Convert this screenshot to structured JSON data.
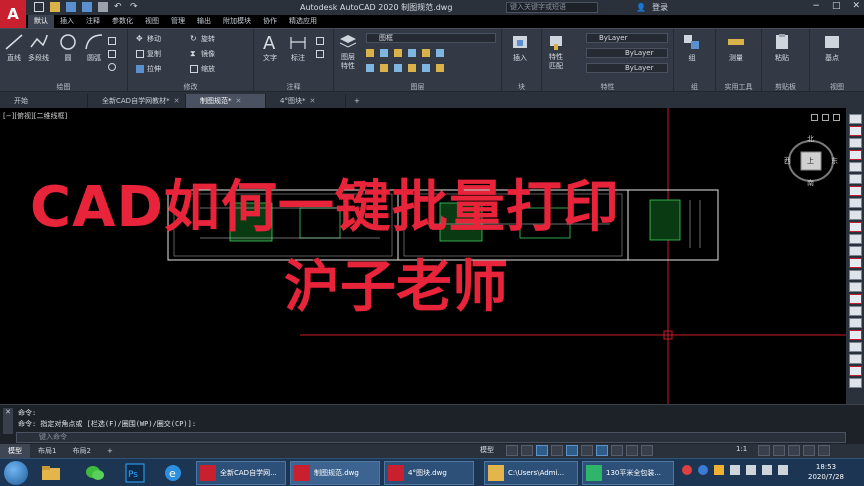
{
  "window": {
    "title": "Autodesk AutoCAD 2020    制图规范.dwg",
    "search_placeholder": "键入关键字或短语",
    "login": "登录",
    "app_logo": "A"
  },
  "ribbon_tabs": [
    "默认",
    "插入",
    "注释",
    "参数化",
    "视图",
    "管理",
    "输出",
    "附加模块",
    "协作",
    "精选应用"
  ],
  "ribbon": {
    "draw": {
      "title": "绘图",
      "line": "直线",
      "polyline": "多段线",
      "circle": "圆",
      "arc": "圆弧"
    },
    "modify": {
      "title": "修改",
      "move": "移动",
      "rotate": "旋转",
      "copy": "复制",
      "mirror": "镜像",
      "stretch": "拉伸",
      "scale": "缩放"
    },
    "annotation": {
      "title": "注释",
      "text": "文字",
      "dimension": "标注"
    },
    "layers": {
      "title": "图层",
      "properties": "图层\n特性",
      "layer_name": "图框"
    },
    "block": {
      "title": "块",
      "insert": "插入"
    },
    "properties": {
      "title": "特性",
      "match": "特性\n匹配",
      "bylayer1": "ByLayer",
      "bylayer2": "ByLayer",
      "bylayer3": "ByLayer"
    },
    "groups": {
      "title": "组",
      "group": "组"
    },
    "utilities": {
      "title": "实用工具",
      "measure": "测量"
    },
    "clipboard": {
      "title": "剪贴板",
      "paste": "粘贴"
    },
    "view": {
      "title": "视图",
      "base": "基点"
    }
  },
  "doc_tabs": [
    {
      "label": "开始"
    },
    {
      "label": "全新CAD自学网教材*"
    },
    {
      "label": "制图规范*"
    },
    {
      "label": "4°图块*"
    }
  ],
  "viewport_label": "[−][俯视][二维线框]",
  "viewcube": {
    "north": "北",
    "south": "南",
    "west": "西",
    "east": "东",
    "top": "上"
  },
  "overlay": {
    "title": "CAD如何一键批量打印",
    "subtitle": "沪子老师"
  },
  "command": {
    "line1": "命令:",
    "line2": "命令: 指定对角点或 [栏选(F)/圈围(WP)/圈交(CP)]:",
    "input_placeholder": "键入命令"
  },
  "layout_tabs": [
    "模型",
    "布局1",
    "布局2"
  ],
  "status": {
    "scale": "1:1",
    "model_label": "模型"
  },
  "taskbar": {
    "items": [
      {
        "label": "全新CAD自学网..."
      },
      {
        "label": "制图规范.dwg"
      },
      {
        "label": "4°图块.dwg"
      },
      {
        "label": "C:\\Users\\Admi..."
      },
      {
        "label": "130平米全包装..."
      }
    ],
    "time": "18:53",
    "date": "2020/7/28"
  },
  "colors": {
    "accent_red": "#e8243a",
    "autocad_red": "#c8202e",
    "ui_dark": "#2b313b"
  }
}
